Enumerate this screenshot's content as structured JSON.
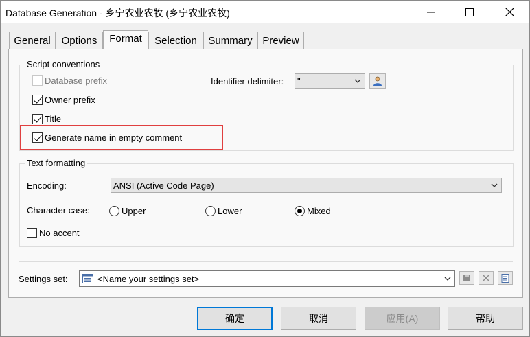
{
  "window": {
    "title": "Database Generation - 乡宁农业农牧 (乡宁农业农牧)"
  },
  "tabs": [
    {
      "label": "General"
    },
    {
      "label": "Options"
    },
    {
      "label": "Format"
    },
    {
      "label": "Selection"
    },
    {
      "label": "Summary"
    },
    {
      "label": "Preview"
    }
  ],
  "active_tab": "Format",
  "script_conventions": {
    "group_label": "Script conventions",
    "database_prefix": {
      "label": "Database prefix",
      "checked": false,
      "enabled": false
    },
    "owner_prefix": {
      "label": "Owner prefix",
      "checked": true
    },
    "title": {
      "label": "Title",
      "checked": true
    },
    "generate_name": {
      "label": "Generate name in empty comment",
      "checked": true
    },
    "identifier_delimiter": {
      "label": "Identifier delimiter:",
      "value": "\""
    }
  },
  "text_formatting": {
    "group_label": "Text formatting",
    "encoding": {
      "label": "Encoding:",
      "value": "ANSI (Active Code Page)"
    },
    "character_case": {
      "label": "Character case:",
      "options": [
        "Upper",
        "Lower",
        "Mixed"
      ],
      "selected": "Mixed"
    },
    "no_accent": {
      "label": "No accent",
      "checked": false
    }
  },
  "settings_set": {
    "label": "Settings set:",
    "value": "<Name your settings set>"
  },
  "buttons": {
    "ok": "确定",
    "cancel": "取消",
    "apply": "应用(A)",
    "help": "帮助"
  },
  "colors": {
    "accent": "#0078d7",
    "highlight_border": "#e04040"
  }
}
